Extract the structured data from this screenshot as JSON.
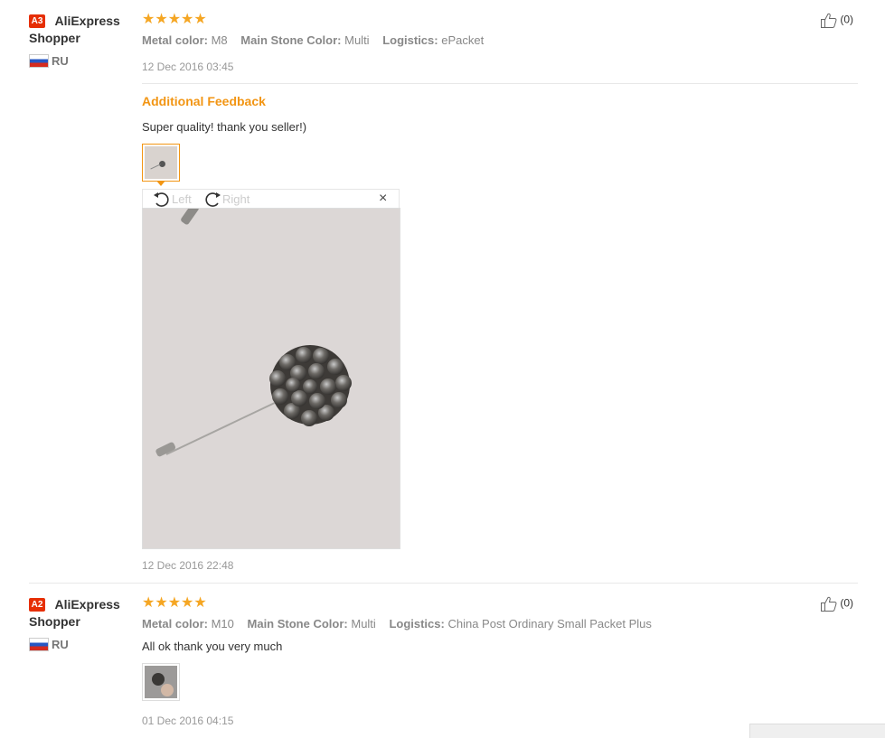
{
  "reviews": [
    {
      "badge": "A3",
      "user_line1": "AliExpress",
      "user_line2": "Shopper",
      "country": "RU",
      "stars": "★★★★★",
      "meta": [
        {
          "label": "Metal color:",
          "value": "M8"
        },
        {
          "label": "Main Stone Color:",
          "value": "Multi"
        },
        {
          "label": "Logistics:",
          "value": "ePacket"
        }
      ],
      "date": "12 Dec 2016 03:45",
      "like_count": "(0)",
      "additional_feedback_title": "Additional Feedback",
      "additional_text": "Super quality! thank you seller!)",
      "viewer": {
        "rotate_left": "Left",
        "rotate_right": "Right",
        "close": "×"
      },
      "additional_date": "12 Dec 2016 22:48"
    },
    {
      "badge": "A2",
      "user_line1": "AliExpress",
      "user_line2": "Shopper",
      "country": "RU",
      "stars": "★★★★★",
      "meta": [
        {
          "label": "Metal color:",
          "value": "M10"
        },
        {
          "label": "Main Stone Color:",
          "value": "Multi"
        },
        {
          "label": "Logistics:",
          "value": "China Post Ordinary Small Packet Plus"
        }
      ],
      "text": "All ok thank you very much",
      "date": "01 Dec 2016 04:15",
      "like_count": "(0)"
    }
  ],
  "colors": {
    "star": "#f5a623",
    "badge": "#e62e04",
    "additional_feedback": "#f29513"
  }
}
